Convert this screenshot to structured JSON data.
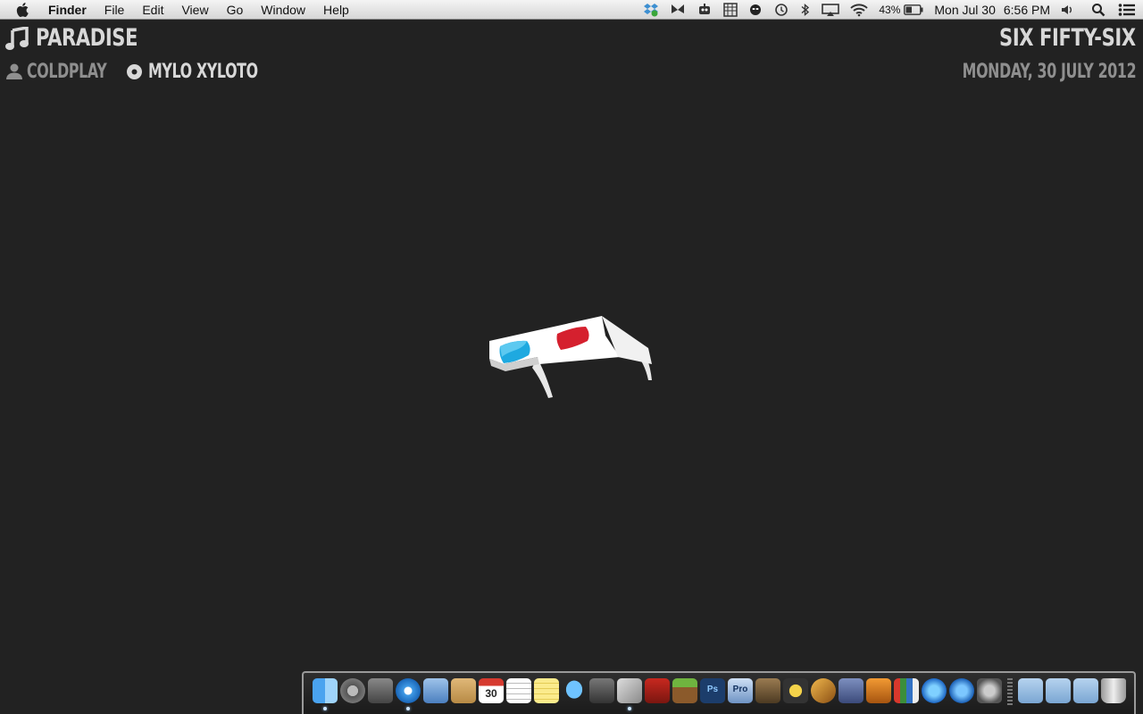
{
  "menubar": {
    "app_name": "Finder",
    "menus": [
      "File",
      "Edit",
      "View",
      "Go",
      "Window",
      "Help"
    ],
    "battery_percent": "43%",
    "date": "Mon Jul 30",
    "time": "6:56 PM"
  },
  "now_playing": {
    "title": "PARADISE",
    "artist": "COLDPLAY",
    "album": "MYLO XYLOTO"
  },
  "clock": {
    "words": "SIX FIFTY-SIX",
    "date": "MONDAY, 30 JULY 2012"
  },
  "dock": {
    "calendar_day": "30",
    "pro_label": "Pro",
    "ps_label": "Ps",
    "icons": [
      "finder-icon",
      "launchpad-icon",
      "mission-control-icon",
      "safari-icon",
      "mail-icon",
      "contacts-icon",
      "calendar-icon",
      "reminders-icon",
      "notes-icon",
      "messages-icon",
      "facetime-icon",
      "photo-booth-icon",
      "photo-icon",
      "minecraft-icon",
      "photoshop-icon",
      "pro-icon",
      "camera-icon",
      "imovie-icon",
      "garageband-icon",
      "preview-icon",
      "keynote-icon",
      "numbers-icon",
      "itunes-icon",
      "app-store-icon",
      "system-preferences-icon",
      "applications-folder-icon",
      "documents-folder-icon",
      "downloads-folder-icon",
      "trash-icon"
    ]
  },
  "colors": {
    "background": "#222222",
    "text_light": "#d8d8d8",
    "text_dim": "#8f8f8f",
    "lens_cyan": "#1ea9e0",
    "lens_red": "#d5202e"
  }
}
